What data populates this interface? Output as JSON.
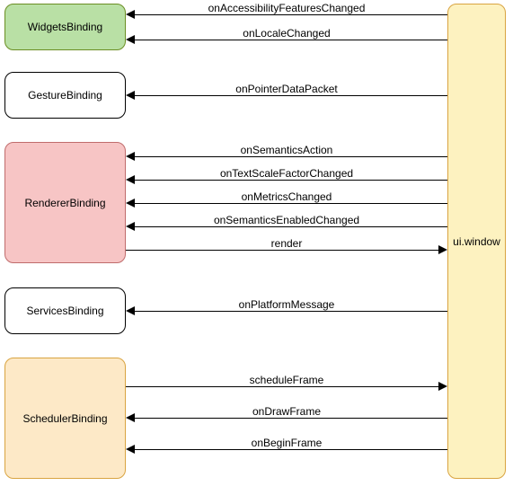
{
  "nodes": {
    "widgets": "WidgetsBinding",
    "gesture": "GestureBinding",
    "renderer": "RendererBinding",
    "services": "ServicesBinding",
    "scheduler": "SchedulerBinding",
    "window": "ui.window"
  },
  "edges": {
    "e1": "onAccessibilityFeaturesChanged",
    "e2": "onLocaleChanged",
    "e3": "onPointerDataPacket",
    "e4": "onSemanticsAction",
    "e5": "onTextScaleFactorChanged",
    "e6": "onMetricsChanged",
    "e7": "onSemanticsEnabledChanged",
    "e8": "render",
    "e9": "onPlatformMessage",
    "e10": "scheduleFrame",
    "e11": "onDrawFrame",
    "e12": "onBeginFrame"
  },
  "chart_data": {
    "type": "diagram",
    "nodes": [
      {
        "id": "widgets",
        "label": "WidgetsBinding",
        "color": "#B9E0A5"
      },
      {
        "id": "gesture",
        "label": "GestureBinding",
        "color": "#FFFFFF"
      },
      {
        "id": "renderer",
        "label": "RendererBinding",
        "color": "#F7C5C5"
      },
      {
        "id": "services",
        "label": "ServicesBinding",
        "color": "#FFFFFF"
      },
      {
        "id": "scheduler",
        "label": "SchedulerBinding",
        "color": "#FDE9C7"
      },
      {
        "id": "window",
        "label": "ui.window",
        "color": "#FDF2C0"
      }
    ],
    "edges": [
      {
        "from": "window",
        "to": "widgets",
        "label": "onAccessibilityFeaturesChanged"
      },
      {
        "from": "window",
        "to": "widgets",
        "label": "onLocaleChanged"
      },
      {
        "from": "window",
        "to": "gesture",
        "label": "onPointerDataPacket"
      },
      {
        "from": "window",
        "to": "renderer",
        "label": "onSemanticsAction"
      },
      {
        "from": "window",
        "to": "renderer",
        "label": "onTextScaleFactorChanged"
      },
      {
        "from": "window",
        "to": "renderer",
        "label": "onMetricsChanged"
      },
      {
        "from": "window",
        "to": "renderer",
        "label": "onSemanticsEnabledChanged"
      },
      {
        "from": "renderer",
        "to": "window",
        "label": "render"
      },
      {
        "from": "window",
        "to": "services",
        "label": "onPlatformMessage"
      },
      {
        "from": "scheduler",
        "to": "window",
        "label": "scheduleFrame"
      },
      {
        "from": "window",
        "to": "scheduler",
        "label": "onDrawFrame"
      },
      {
        "from": "window",
        "to": "scheduler",
        "label": "onBeginFrame"
      }
    ]
  }
}
